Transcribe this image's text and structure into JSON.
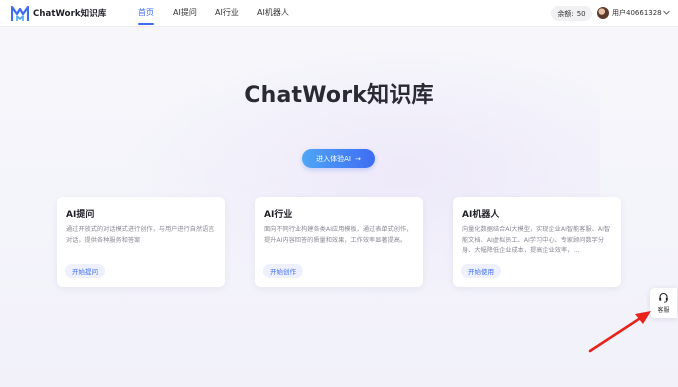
{
  "header": {
    "brand": "ChatWork知识库",
    "nav": [
      "首页",
      "AI提问",
      "AI行业",
      "AI机器人"
    ],
    "balance_label": "余额:",
    "balance_value": "50",
    "username": "用户40661328"
  },
  "hero": {
    "title": "ChatWork知识库",
    "cta_label": "进入体验AI",
    "cta_arrow": "→"
  },
  "cards": [
    {
      "title": "AI提问",
      "desc": "通过开放式的对话模式进行创作，与用户进行自然语言对话，提供各种服务和答案",
      "button": "开始提问"
    },
    {
      "title": "AI行业",
      "desc": "面向不同行业构建各类AI应用模板，通过表单式创作，提升AI内容回答的质量和效果，工作效率显著提高。",
      "button": "开始创作"
    },
    {
      "title": "AI机器人",
      "desc": "向量化数据结合AI大模型，实现企业AI智能客服、AI智能文档、AI虚拟员工、AI学习中心、专家顾问数字分身、大幅降低企业成本，提高企业效率，...",
      "button": "开始使用"
    }
  ],
  "service": {
    "label": "客服",
    "icon": "headset-icon"
  },
  "colors": {
    "accent": "#3f6cf3",
    "annotation_arrow": "#e8231b"
  }
}
